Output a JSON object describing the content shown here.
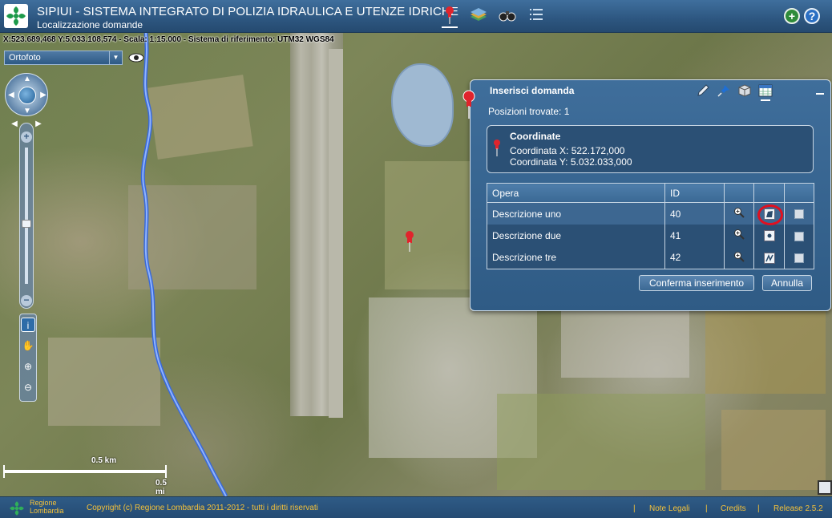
{
  "header": {
    "title": "SIPIUI - SISTEMA INTEGRATO DI POLIZIA IDRAULICA E UTENZE IDRICHE",
    "subtitle": "Localizzazione domande",
    "tools": [
      "pin-icon",
      "layers-icon",
      "binoculars-icon",
      "list-icon"
    ],
    "right_tools": [
      "add-icon",
      "help-icon"
    ]
  },
  "map": {
    "coord_readout": "X:523.689,468 Y:5.033.108,574 - Scala: 1:15.000 - Sistema di riferimento: UTM32 WGS84",
    "layer_select": "Ortofoto",
    "scale_km": "0.5 km",
    "scale_mi": "0.5 mi"
  },
  "panel": {
    "title": "Inserisci domanda",
    "tools": [
      "pencil-icon",
      "pushpin-icon",
      "cube-icon",
      "table-icon"
    ],
    "positions_found": "Posizioni trovate: 1",
    "coord_box": {
      "title": "Coordinate",
      "x": "Coordinata X: 522.172,000",
      "y": "Coordinata Y: 5.032.033,000"
    },
    "grid": {
      "headers": [
        "Opera",
        "ID",
        "",
        "",
        ""
      ],
      "rows": [
        {
          "opera": "Descrizione uno",
          "id": "40",
          "geometry": "polygon-icon"
        },
        {
          "opera": "Descrizione due",
          "id": "41",
          "geometry": "point-icon"
        },
        {
          "opera": "Descrizione tre",
          "id": "42",
          "geometry": "line-icon"
        }
      ]
    },
    "confirm_button": "Conferma inserimento",
    "cancel_button": "Annulla"
  },
  "footer": {
    "brand_line1": "Regione",
    "brand_line2": "Lombardia",
    "copyright": "Copyright (c) Regione Lombardia 2011-2012 - tutti i diritti riservati",
    "separator": "|",
    "legal": "Note Legali",
    "credits": "Credits",
    "release": "Release 2.5.2"
  },
  "colors": {
    "header_blue": "#2d5680",
    "panel_blue": "#3f6e9b",
    "footer_text": "#f5c23a",
    "highlight_red": "#e01020",
    "river_blue": "#5d8df0"
  }
}
